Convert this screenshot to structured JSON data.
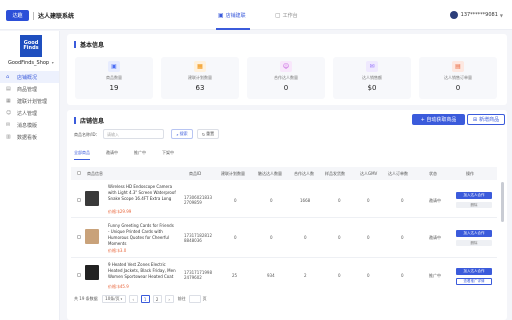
{
  "app": {
    "name": "达人建联系统",
    "logo_text": "达趣"
  },
  "top_tabs": [
    {
      "label": "店铺建联",
      "icon": "store-icon",
      "active": true
    },
    {
      "label": "工作台",
      "icon": "desk-icon",
      "active": false
    }
  ],
  "user": {
    "phone": "137******9081"
  },
  "shop": {
    "logo_text": "Good Finds",
    "name": "GoodFinds_Shop"
  },
  "sidebar": {
    "items": [
      {
        "label": "店铺概况",
        "icon": "home-icon"
      },
      {
        "label": "商品管理",
        "icon": "box-icon"
      },
      {
        "label": "建联计划管理",
        "icon": "plan-icon"
      },
      {
        "label": "达人管理",
        "icon": "user-icon"
      },
      {
        "label": "消息模版",
        "icon": "message-icon"
      },
      {
        "label": "数据看板",
        "icon": "chart-icon"
      }
    ]
  },
  "basic_info": {
    "title": "基本信息",
    "stats": [
      {
        "label": "商品数量",
        "value": "19",
        "icon": "product-icon",
        "color": "#4c6ef5",
        "bg": "#e7ecfe"
      },
      {
        "label": "建联计划数量",
        "value": "63",
        "icon": "calendar-icon",
        "color": "#f08c00",
        "bg": "#fff1dc"
      },
      {
        "label": "合作达人数量",
        "value": "0",
        "icon": "people-icon",
        "color": "#be4bdb",
        "bg": "#f8e7fb"
      },
      {
        "label": "达人销售额",
        "value": "$0",
        "icon": "sales-icon",
        "color": "#9775fa",
        "bg": "#efe9fe"
      },
      {
        "label": "达人销售订单量",
        "value": "0",
        "icon": "order-icon",
        "color": "#e8643a",
        "bg": "#fde8e1"
      }
    ]
  },
  "store_info": {
    "title": "店铺信息",
    "btn_auto": "+ 自动获取商品",
    "btn_add": "新增商品",
    "search_label": "商品名称/ID：",
    "search_placeholder": "请输入",
    "btn_search": "搜索",
    "btn_reset": "重置",
    "subtabs": [
      "全部商品",
      "邀请中",
      "推广中",
      "下架中"
    ],
    "columns": [
      "商品信息",
      "商品ID",
      "建联计划数量",
      "触达达人数量",
      "合作达人数",
      "样品发货数",
      "达人GMV",
      "达人订单数",
      "状态",
      "操作"
    ],
    "rows": [
      {
        "title": "Wireless HD Endoscope Camera with Light 4.3\" Screen Waterproof Snake Scope 16.4FT Extra Long",
        "price": "价格:$29.99",
        "id": "17306021833 2709859",
        "plans": "0",
        "reached": "0",
        "partners": "1668",
        "samples": "0",
        "gmv": "0",
        "orders": "0",
        "status": "邀请中",
        "actions": [
          "加入达人合作",
          "删除"
        ],
        "thumb_color": "#3a3a3a"
      },
      {
        "title": "Funny Greeting Cards for Friends - Unique Printed Cards with Humorous Quotes for Cheerful Moments",
        "price": "价格:$3.0",
        "id": "17317182812 8848036",
        "plans": "0",
        "reached": "0",
        "partners": "0",
        "samples": "0",
        "gmv": "0",
        "orders": "0",
        "status": "邀请中",
        "actions": [
          "加入达人合作",
          "删除"
        ],
        "thumb_color": "#c9a27a"
      },
      {
        "title": "9 Heated Vest Zones Electric Heated Jackets, Black Friday, Men Women Sportswear Heated Coat",
        "price": "价格:$45.9",
        "id": "17317171998 2479602",
        "plans": "25",
        "reached": "934",
        "partners": "2",
        "samples": "0",
        "gmv": "0",
        "orders": "0",
        "status": "推广中",
        "actions": [
          "加入达人合作",
          "查看推广详情"
        ],
        "thumb_color": "#222"
      }
    ],
    "pagination": {
      "total": "共 19 条数据",
      "page_size": "10条/页",
      "pages": [
        "1",
        "2"
      ],
      "prev": "‹",
      "next": "›",
      "jump_label": "前往",
      "jump_suffix": "页"
    }
  }
}
